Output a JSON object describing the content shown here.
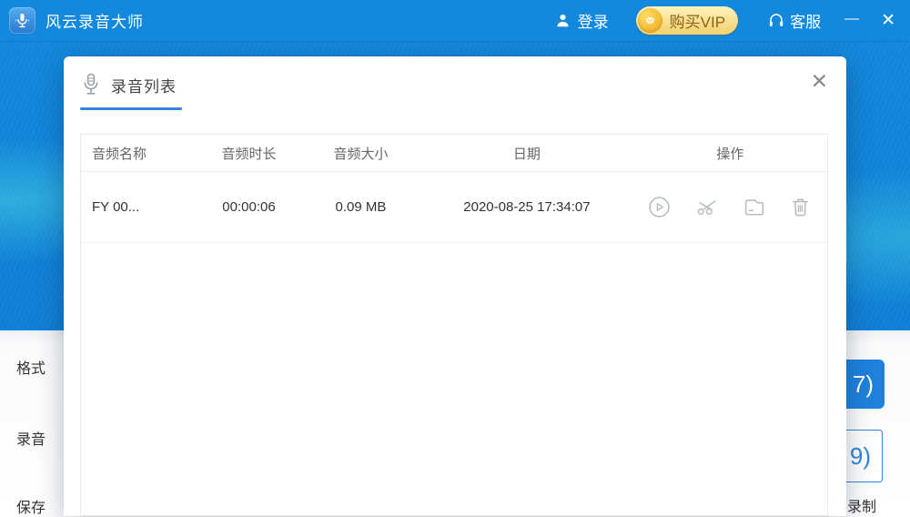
{
  "colors": {
    "titlebar_bg": "#1289dc",
    "accent_blue": "#2e87e0",
    "vip_text": "#8a6418",
    "action_icon_gray": "#b9bdc3",
    "primary_button_bg": "#1e82dd"
  },
  "titlebar": {
    "app_title": "风云录音大师",
    "login": "登录",
    "vip": "购买VIP",
    "service": "客服",
    "minimize": "—",
    "close": "✕"
  },
  "modal": {
    "title": "录音列表",
    "close": "✕",
    "table": {
      "headers": [
        "音频名称",
        "音频时长",
        "音频大小",
        "日期",
        "操作"
      ],
      "rows": [
        {
          "name": "FY 00...",
          "duration": "00:00:06",
          "size": "0.09 MB",
          "date": "2020-08-25 17:34:07"
        }
      ],
      "row_action_icons": [
        "play-icon",
        "cut-icon",
        "folder-icon",
        "delete-icon"
      ]
    }
  },
  "background": {
    "labels": [
      "格式",
      "录音",
      "保存"
    ],
    "primary_button": "7)",
    "secondary_button": "9)",
    "record_label": "录制"
  }
}
